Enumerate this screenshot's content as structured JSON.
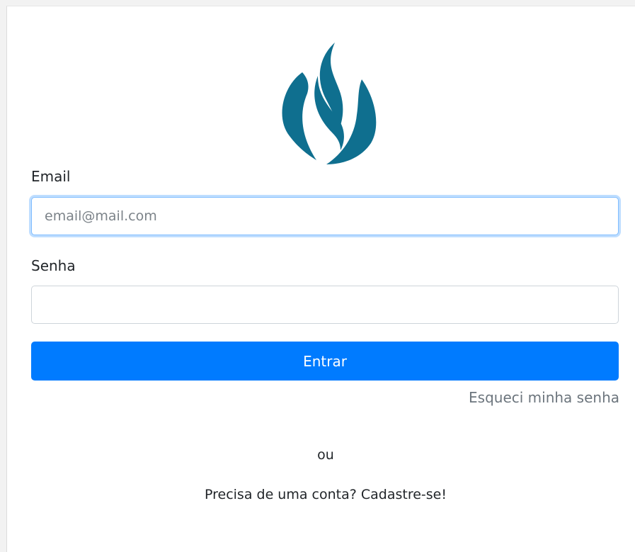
{
  "form": {
    "email_label": "Email",
    "email_placeholder": "email@mail.com",
    "email_value": "",
    "password_label": "Senha",
    "password_value": "",
    "submit_label": "Entrar",
    "forgot_link": "Esqueci minha senha",
    "separator": "ou",
    "signup_link": "Precisa de uma conta? Cadastre-se!"
  },
  "icons": {
    "logo": "flame-logo-icon"
  },
  "colors": {
    "logo": "#0f6f8f",
    "primary_button": "#007bff",
    "focus_border": "#80bdff",
    "muted_link": "#6c757d"
  }
}
